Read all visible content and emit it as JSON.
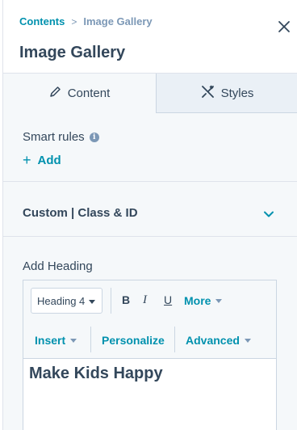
{
  "breadcrumb": {
    "parent": "Contents",
    "separator": ">",
    "current": "Image Gallery"
  },
  "panel": {
    "title": "Image Gallery"
  },
  "tabs": [
    {
      "label": "Content",
      "icon": "pencil-icon",
      "active": true
    },
    {
      "label": "Styles",
      "icon": "brush-icon",
      "active": false
    }
  ],
  "smart_rules": {
    "label": "Smart rules",
    "info_glyph": "i",
    "add_label": "Add",
    "add_glyph": "+"
  },
  "custom_section": {
    "label": "Custom | Class & ID",
    "expanded": false
  },
  "heading_field": {
    "label": "Add Heading"
  },
  "toolbar": {
    "format_select": "Heading 4",
    "bold": "B",
    "italic": "I",
    "underline": "U",
    "more": "More",
    "insert": "Insert",
    "personalize": "Personalize",
    "advanced": "Advanced"
  },
  "editor": {
    "content": "Make Kids Happy"
  },
  "colors": {
    "link": "#0091ae",
    "text": "#33475b",
    "muted": "#7c98b6",
    "panel_bg": "#f5f8fa",
    "border": "#cbd6e2"
  }
}
